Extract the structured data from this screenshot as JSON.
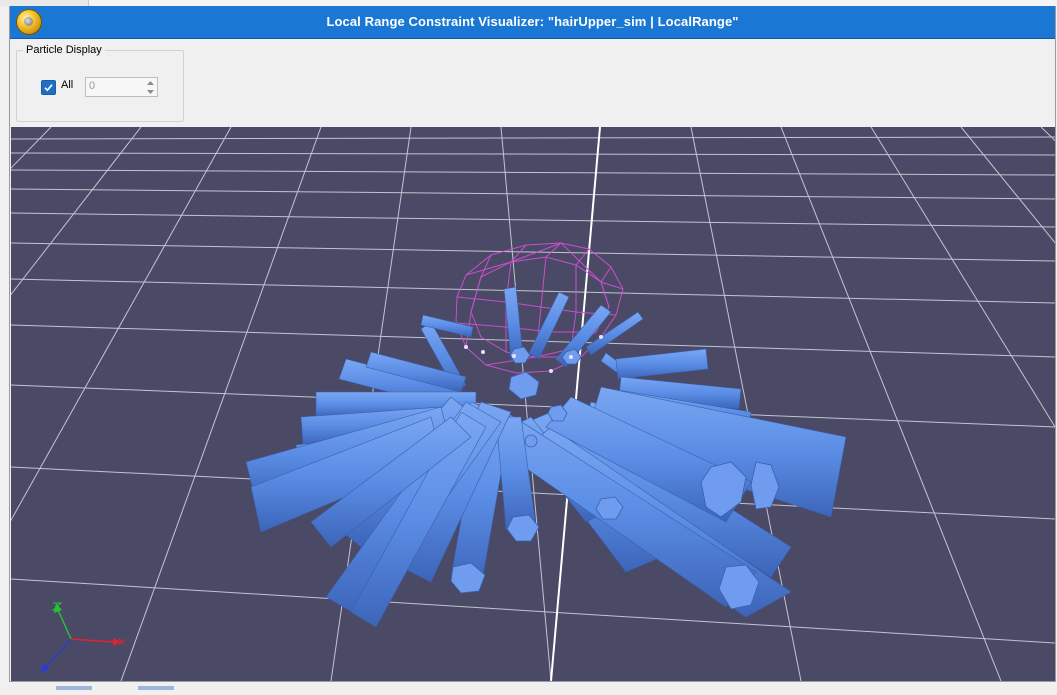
{
  "window": {
    "title": "Local Range Constraint Visualizer: \"hairUpper_sim | LocalRange\"",
    "app_icon": "app-orb-icon",
    "accent": "#1a78d4"
  },
  "particle_display": {
    "group_label": "Particle Display",
    "all_checkbox": {
      "label": "All",
      "checked": true
    },
    "particle_index": {
      "value": "0",
      "enabled": false
    }
  },
  "viewport": {
    "background": "#4b4a66",
    "grid_color": "#d9d9e3",
    "mesh_color": "#d64fd8",
    "cylinder_color": "#5b8de6",
    "axis_gizmo": {
      "x_color": "#e0242a",
      "y_color": "#27c234",
      "z_color": "#2a3bd8"
    }
  }
}
